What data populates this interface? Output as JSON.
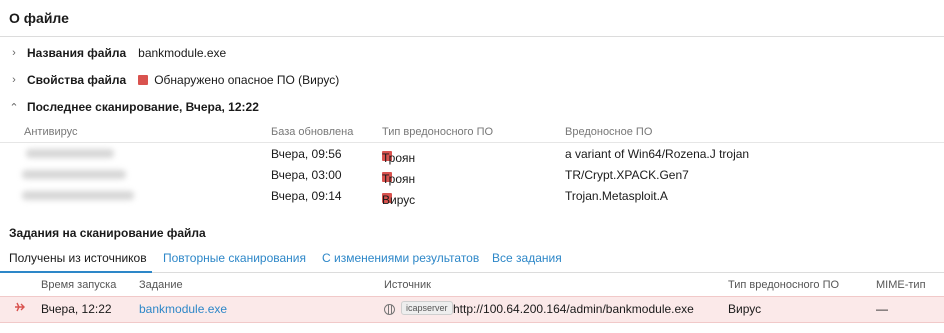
{
  "header": {
    "title": "О файле"
  },
  "file_names": {
    "label": "Названия файла",
    "value": "bankmodule.exe"
  },
  "file_props": {
    "label": "Свойства файла",
    "value": "Обнаружено опасное ПО (Вирус)",
    "status_color": "#d9534f"
  },
  "last_scan": {
    "label": "Последнее сканирование, Вчера, 12:22"
  },
  "av_table": {
    "columns": [
      "Антивирус",
      "База обновлена",
      "Тип вредоносного ПО",
      "Вредоносное ПО"
    ],
    "rows": [
      {
        "updated": "Вчера, 09:56",
        "type": "Троян",
        "malware": "a variant of Win64/Rozena.J trojan"
      },
      {
        "updated": "Вчера, 03:00",
        "type": "Троян",
        "malware": "TR/Crypt.XPACK.Gen7"
      },
      {
        "updated": "Вчера, 09:14",
        "type": "Вирус",
        "malware": "Trojan.Metasploit.A"
      }
    ]
  },
  "tasks": {
    "title": "Задания на сканирование файла",
    "tabs": [
      {
        "label": "Получены из источников",
        "active": true
      },
      {
        "label": "Повторные сканирования",
        "active": false
      },
      {
        "label": "С изменениями результатов",
        "active": false
      },
      {
        "label": "Все задания",
        "active": false
      }
    ],
    "columns": [
      "Время запуска",
      "Задание",
      "Источник",
      "Тип вредоносного ПО",
      "MIME-тип"
    ],
    "rows": [
      {
        "time": "Вчера, 12:22",
        "task": "bankmodule.exe",
        "source_tag": "icapserver",
        "source_url": "http://100.64.200.164/admin/bankmodule.exe",
        "malware_type": "Вирус",
        "mime": "—"
      }
    ]
  },
  "colors": {
    "accent": "#2d87c8",
    "danger": "#d9534f",
    "danger_row": "#fbe9e9"
  }
}
